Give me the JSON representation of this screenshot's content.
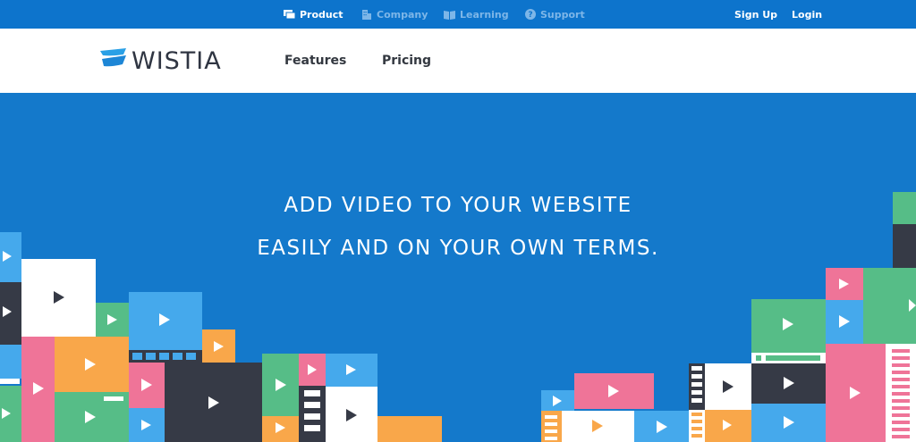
{
  "top_nav": {
    "items": [
      {
        "label": "Product",
        "icon": "product-icon",
        "active": true
      },
      {
        "label": "Company",
        "icon": "building-icon",
        "active": false
      },
      {
        "label": "Learning",
        "icon": "book-icon",
        "active": false
      },
      {
        "label": "Support",
        "icon": "help-icon",
        "active": false
      }
    ],
    "signup_label": "Sign Up",
    "login_label": "Login"
  },
  "main_nav": {
    "logo_text": "WISTIA",
    "links": [
      {
        "label": "Features"
      },
      {
        "label": "Pricing"
      }
    ]
  },
  "hero": {
    "headline_line1": "ADD VIDEO TO YOUR WEBSITE",
    "headline_line2": "EASILY AND ON YOUR OWN TERMS."
  },
  "colors": {
    "top_bar": "#0d74cc",
    "hero_bg": "#1479cb",
    "text_dark": "#2f3542",
    "dim_link": "#7db6e8",
    "tile_blue": "#45a9ec",
    "tile_pink": "#ef7498",
    "tile_orange": "#f9a74a",
    "tile_green": "#56bd87",
    "tile_dark": "#363a46",
    "tile_white": "#ffffff"
  }
}
